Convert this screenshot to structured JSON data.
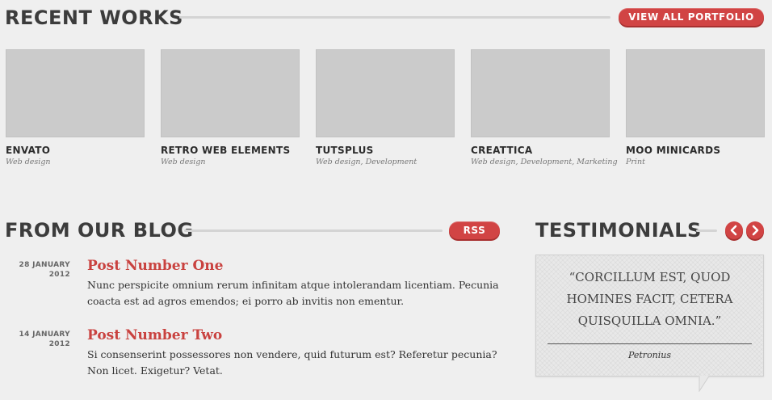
{
  "recent_works": {
    "title": "RECENT WORKS",
    "view_all_label": "VIEW ALL PORTFOLIO",
    "items": [
      {
        "name": "ENVATO",
        "tags": "Web design"
      },
      {
        "name": "RETRO WEB ELEMENTS",
        "tags": "Web design"
      },
      {
        "name": "TUTSPLUS",
        "tags": "Web design, Development"
      },
      {
        "name": "CREATTICA",
        "tags": "Web design, Development, Marketing"
      },
      {
        "name": "MOO MINICARDS",
        "tags": "Print"
      }
    ]
  },
  "blog": {
    "title": "FROM OUR BLOG",
    "rss_label": "RSS",
    "posts": [
      {
        "date_day_month": "28 JANUARY",
        "date_year": "2012",
        "title": "Post Number One",
        "excerpt": "Nunc perspicite omnium rerum infinitam atque intolerandam licentiam. Pecunia coacta est ad agros emendos; ei porro ab invitis non ementur."
      },
      {
        "date_day_month": "14 JANUARY",
        "date_year": "2012",
        "title": "Post Number Two",
        "excerpt": "Si consenserint possessores non vendere, quid futurum est? Referetur pecunia? Non licet. Exigetur? Vetat."
      }
    ]
  },
  "testimonials": {
    "title": "TESTIMONIALS",
    "prev_icon": "chevron-left-icon",
    "next_icon": "chevron-right-icon",
    "quote": "“CORCILLUM EST, QUOD HOMINES FACIT, CETERA QUISQUILLA OMNIA.”",
    "author": "Petronius"
  },
  "colors": {
    "accent": "#d14444",
    "post_title": "#c9423f",
    "background": "#efefef",
    "thumb": "#cbcbcb"
  }
}
